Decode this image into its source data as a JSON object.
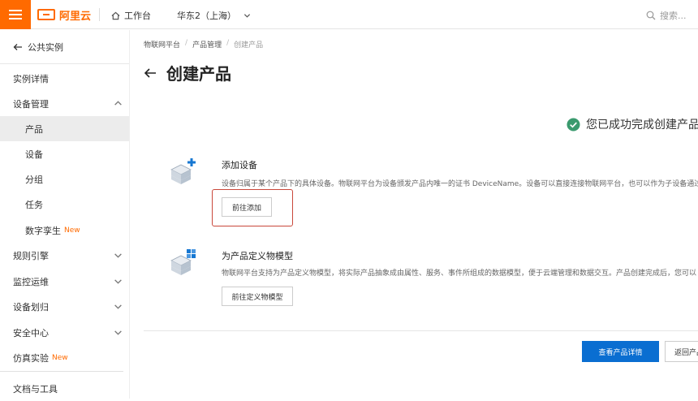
{
  "topbar": {
    "logo_text": "阿里云",
    "workbench": "工作台",
    "region": "华东2（上海）",
    "search_placeholder": "搜索..."
  },
  "sidebar": {
    "back_label": "公共实例",
    "items": [
      {
        "label": "实例详情"
      },
      {
        "label": "设备管理"
      },
      {
        "label": "产品"
      },
      {
        "label": "设备"
      },
      {
        "label": "分组"
      },
      {
        "label": "任务"
      },
      {
        "label": "数字孪生",
        "badge": "New"
      },
      {
        "label": "规则引擎"
      },
      {
        "label": "监控运维"
      },
      {
        "label": "设备划归"
      },
      {
        "label": "安全中心"
      },
      {
        "label": "仿真实验",
        "badge": "New"
      },
      {
        "label": "文档与工具"
      }
    ]
  },
  "breadcrumb": [
    "物联网平台",
    "产品管理",
    "创建产品"
  ],
  "page_title": "创建产品",
  "success_message": "您已成功完成创建产品",
  "steps": [
    {
      "title": "添加设备",
      "desc": "设备归属于某个产品下的具体设备。物联网平台为设备颁发产品内唯一的证书 DeviceName。设备可以直接连接物联网平台，也可以作为子设备通过",
      "button": "前往添加"
    },
    {
      "title": "为产品定义物模型",
      "desc": "物联网平台支持为产品定义物模型，将实际产品抽象成由属性、服务、事件所组成的数据模型，便于云端管理和数据交互。产品创建完成后，您可以",
      "button": "前往定义物模型"
    }
  ],
  "footer": {
    "primary": "查看产品详情",
    "secondary": "返回产品列表"
  },
  "colors": {
    "brand": "#ff6a00",
    "primary": "#0a6ed1",
    "success": "#3a9a6e",
    "highlight": "#c9483b"
  }
}
